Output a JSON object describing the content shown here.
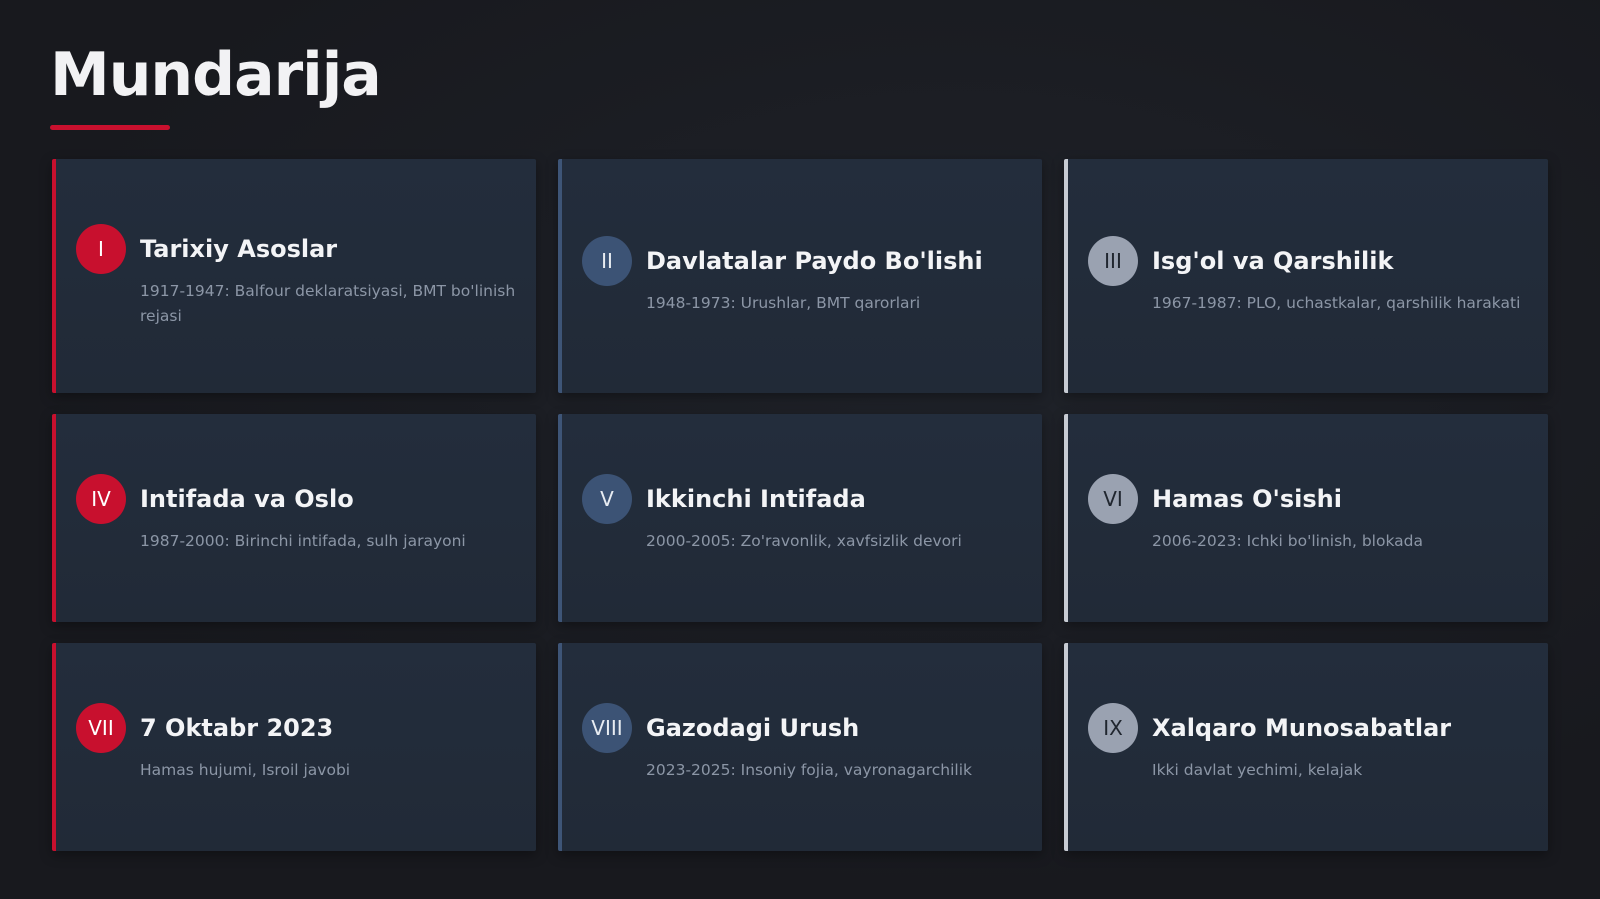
{
  "slide": {
    "title": "Mundarija",
    "accent_color": "#c8102e"
  },
  "cards": [
    {
      "numeral": "I",
      "title": "Tarixiy Asoslar",
      "desc": "1917-1947: Balfour deklaratsiyasi, BMT bo'linish rejasi",
      "style": "red"
    },
    {
      "numeral": "II",
      "title": "Davlatalar Paydo Bo'lishi",
      "desc": "1948-1973: Urushlar, BMT qarorlari",
      "style": "blue"
    },
    {
      "numeral": "III",
      "title": "Isg'ol va Qarshilik",
      "desc": "1967-1987: PLO, uchastkalar, qarshilik harakati",
      "style": "grey"
    },
    {
      "numeral": "IV",
      "title": "Intifada va Oslo",
      "desc": "1987-2000: Birinchi intifada, sulh jarayoni",
      "style": "red"
    },
    {
      "numeral": "V",
      "title": "Ikkinchi Intifada",
      "desc": "2000-2005: Zo'ravonlik, xavfsizlik devori",
      "style": "blue"
    },
    {
      "numeral": "VI",
      "title": "Hamas O'sishi",
      "desc": "2006-2023: Ichki bo'linish, blokada",
      "style": "grey"
    },
    {
      "numeral": "VII",
      "title": "7 Oktabr 2023",
      "desc": "Hamas hujumi, Isroil javobi",
      "style": "red"
    },
    {
      "numeral": "VIII",
      "title": "Gazodagi Urush",
      "desc": "2023-2025: Insoniy fojia, vayronagarchilik",
      "style": "blue"
    },
    {
      "numeral": "IX",
      "title": "Xalqaro Munosabatlar",
      "desc": "Ikki davlat yechimi, kelajak",
      "style": "grey"
    }
  ]
}
